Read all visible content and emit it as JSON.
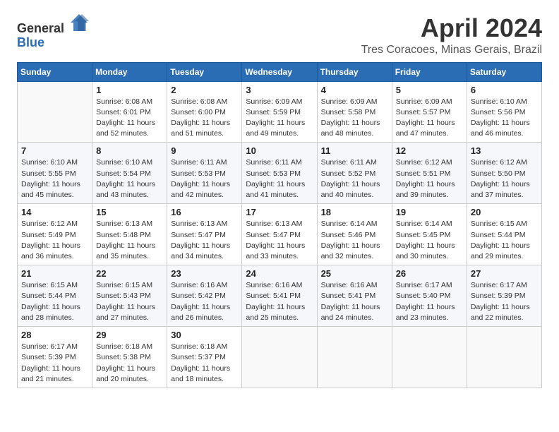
{
  "header": {
    "logo_general": "General",
    "logo_blue": "Blue",
    "month_title": "April 2024",
    "location": "Tres Coracoes, Minas Gerais, Brazil"
  },
  "weekdays": [
    "Sunday",
    "Monday",
    "Tuesday",
    "Wednesday",
    "Thursday",
    "Friday",
    "Saturday"
  ],
  "weeks": [
    [
      {
        "day": "",
        "info": ""
      },
      {
        "day": "1",
        "info": "Sunrise: 6:08 AM\nSunset: 6:01 PM\nDaylight: 11 hours\nand 52 minutes."
      },
      {
        "day": "2",
        "info": "Sunrise: 6:08 AM\nSunset: 6:00 PM\nDaylight: 11 hours\nand 51 minutes."
      },
      {
        "day": "3",
        "info": "Sunrise: 6:09 AM\nSunset: 5:59 PM\nDaylight: 11 hours\nand 49 minutes."
      },
      {
        "day": "4",
        "info": "Sunrise: 6:09 AM\nSunset: 5:58 PM\nDaylight: 11 hours\nand 48 minutes."
      },
      {
        "day": "5",
        "info": "Sunrise: 6:09 AM\nSunset: 5:57 PM\nDaylight: 11 hours\nand 47 minutes."
      },
      {
        "day": "6",
        "info": "Sunrise: 6:10 AM\nSunset: 5:56 PM\nDaylight: 11 hours\nand 46 minutes."
      }
    ],
    [
      {
        "day": "7",
        "info": "Sunrise: 6:10 AM\nSunset: 5:55 PM\nDaylight: 11 hours\nand 45 minutes."
      },
      {
        "day": "8",
        "info": "Sunrise: 6:10 AM\nSunset: 5:54 PM\nDaylight: 11 hours\nand 43 minutes."
      },
      {
        "day": "9",
        "info": "Sunrise: 6:11 AM\nSunset: 5:53 PM\nDaylight: 11 hours\nand 42 minutes."
      },
      {
        "day": "10",
        "info": "Sunrise: 6:11 AM\nSunset: 5:53 PM\nDaylight: 11 hours\nand 41 minutes."
      },
      {
        "day": "11",
        "info": "Sunrise: 6:11 AM\nSunset: 5:52 PM\nDaylight: 11 hours\nand 40 minutes."
      },
      {
        "day": "12",
        "info": "Sunrise: 6:12 AM\nSunset: 5:51 PM\nDaylight: 11 hours\nand 39 minutes."
      },
      {
        "day": "13",
        "info": "Sunrise: 6:12 AM\nSunset: 5:50 PM\nDaylight: 11 hours\nand 37 minutes."
      }
    ],
    [
      {
        "day": "14",
        "info": "Sunrise: 6:12 AM\nSunset: 5:49 PM\nDaylight: 11 hours\nand 36 minutes."
      },
      {
        "day": "15",
        "info": "Sunrise: 6:13 AM\nSunset: 5:48 PM\nDaylight: 11 hours\nand 35 minutes."
      },
      {
        "day": "16",
        "info": "Sunrise: 6:13 AM\nSunset: 5:47 PM\nDaylight: 11 hours\nand 34 minutes."
      },
      {
        "day": "17",
        "info": "Sunrise: 6:13 AM\nSunset: 5:47 PM\nDaylight: 11 hours\nand 33 minutes."
      },
      {
        "day": "18",
        "info": "Sunrise: 6:14 AM\nSunset: 5:46 PM\nDaylight: 11 hours\nand 32 minutes."
      },
      {
        "day": "19",
        "info": "Sunrise: 6:14 AM\nSunset: 5:45 PM\nDaylight: 11 hours\nand 30 minutes."
      },
      {
        "day": "20",
        "info": "Sunrise: 6:15 AM\nSunset: 5:44 PM\nDaylight: 11 hours\nand 29 minutes."
      }
    ],
    [
      {
        "day": "21",
        "info": "Sunrise: 6:15 AM\nSunset: 5:44 PM\nDaylight: 11 hours\nand 28 minutes."
      },
      {
        "day": "22",
        "info": "Sunrise: 6:15 AM\nSunset: 5:43 PM\nDaylight: 11 hours\nand 27 minutes."
      },
      {
        "day": "23",
        "info": "Sunrise: 6:16 AM\nSunset: 5:42 PM\nDaylight: 11 hours\nand 26 minutes."
      },
      {
        "day": "24",
        "info": "Sunrise: 6:16 AM\nSunset: 5:41 PM\nDaylight: 11 hours\nand 25 minutes."
      },
      {
        "day": "25",
        "info": "Sunrise: 6:16 AM\nSunset: 5:41 PM\nDaylight: 11 hours\nand 24 minutes."
      },
      {
        "day": "26",
        "info": "Sunrise: 6:17 AM\nSunset: 5:40 PM\nDaylight: 11 hours\nand 23 minutes."
      },
      {
        "day": "27",
        "info": "Sunrise: 6:17 AM\nSunset: 5:39 PM\nDaylight: 11 hours\nand 22 minutes."
      }
    ],
    [
      {
        "day": "28",
        "info": "Sunrise: 6:17 AM\nSunset: 5:39 PM\nDaylight: 11 hours\nand 21 minutes."
      },
      {
        "day": "29",
        "info": "Sunrise: 6:18 AM\nSunset: 5:38 PM\nDaylight: 11 hours\nand 20 minutes."
      },
      {
        "day": "30",
        "info": "Sunrise: 6:18 AM\nSunset: 5:37 PM\nDaylight: 11 hours\nand 18 minutes."
      },
      {
        "day": "",
        "info": ""
      },
      {
        "day": "",
        "info": ""
      },
      {
        "day": "",
        "info": ""
      },
      {
        "day": "",
        "info": ""
      }
    ]
  ]
}
